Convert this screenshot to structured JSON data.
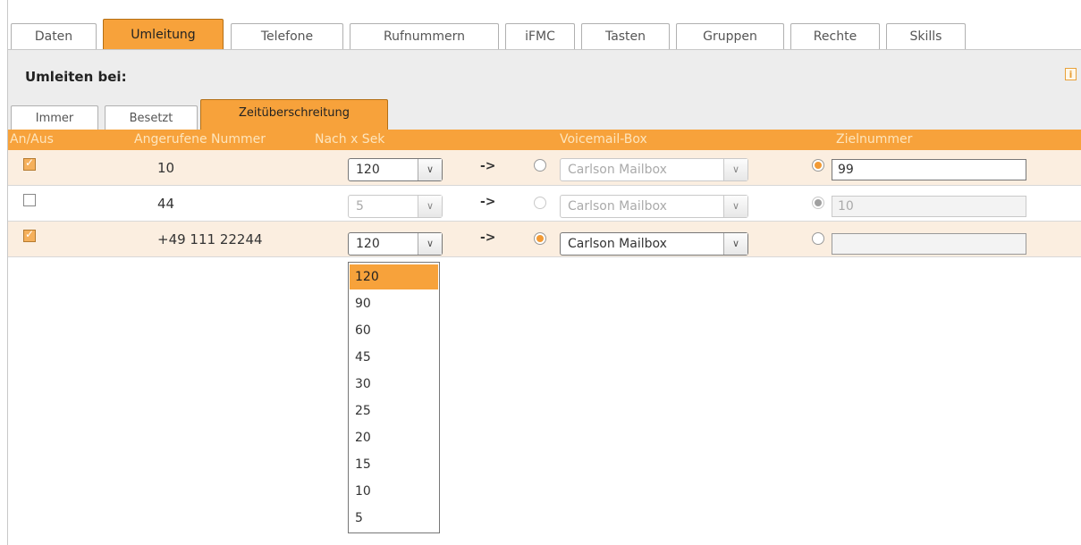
{
  "tabs": [
    "Daten",
    "Umleitung",
    "Telefone",
    "Rufnummern",
    "iFMC",
    "Tasten",
    "Gruppen",
    "Rechte",
    "Skills"
  ],
  "active_tab": "Umleitung",
  "section_title": "Umleiten bei:",
  "info_icon": "info-icon",
  "sub_tabs": [
    "Immer",
    "Besetzt",
    "Zeitüberschreitung"
  ],
  "active_sub_tab": "Zeitüberschreitung",
  "columns": {
    "on_off": "An/Aus",
    "called_number": "Angerufene Nummer",
    "after_seconds": "Nach x Sek",
    "voicemail": "Voicemail-Box",
    "target": "Zielnummer"
  },
  "rows": [
    {
      "enabled": true,
      "number": "10",
      "seconds": "120",
      "arrow": "->",
      "voicemail_selected": false,
      "mailbox": "Carlson Mailbox",
      "target_selected": true,
      "target": "99"
    },
    {
      "enabled": false,
      "number": "44",
      "seconds": "5",
      "arrow": "->",
      "voicemail_selected": false,
      "mailbox": "Carlson Mailbox",
      "target_selected": true,
      "target": "10"
    },
    {
      "enabled": true,
      "number": "+49 111 22244",
      "seconds": "120",
      "arrow": "->",
      "voicemail_selected": true,
      "mailbox": "Carlson Mailbox",
      "target_selected": false,
      "target": ""
    }
  ],
  "dropdown_options": [
    "120",
    "90",
    "60",
    "45",
    "30",
    "25",
    "20",
    "15",
    "10",
    "5"
  ],
  "dropdown_highlighted": "120",
  "colors": {
    "accent": "#f7a23b",
    "row_bg": "#fbeee0"
  }
}
